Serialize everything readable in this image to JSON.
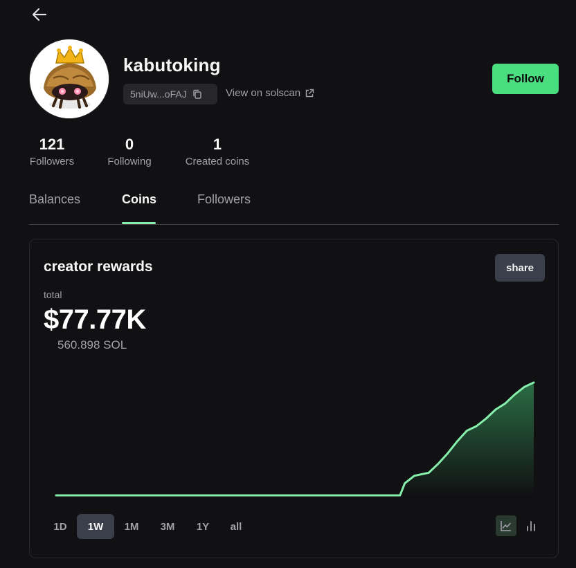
{
  "nav": {
    "back_icon": "arrow-left-icon"
  },
  "profile": {
    "username": "kabutoking",
    "address": "5niUw...oFAJ",
    "copy_icon": "copy-icon",
    "solscan_label": "View on solscan",
    "external_icon": "external-link-icon",
    "follow_label": "Follow"
  },
  "stats": [
    {
      "value": "121",
      "label": "Followers"
    },
    {
      "value": "0",
      "label": "Following"
    },
    {
      "value": "1",
      "label": "Created coins"
    }
  ],
  "tabs": [
    {
      "label": "Balances",
      "active": false
    },
    {
      "label": "Coins",
      "active": true
    },
    {
      "label": "Followers",
      "active": false
    }
  ],
  "rewards": {
    "title": "creator rewards",
    "share_label": "share",
    "total_label": "total",
    "total_value": "$77.77K",
    "sol_value": "560.898 SOL"
  },
  "time_ranges": [
    {
      "label": "1D",
      "active": false
    },
    {
      "label": "1W",
      "active": true
    },
    {
      "label": "1M",
      "active": false
    },
    {
      "label": "3M",
      "active": false
    },
    {
      "label": "1Y",
      "active": false
    },
    {
      "label": "all",
      "active": false
    }
  ],
  "view_toggle": {
    "line_icon": "line-chart-icon",
    "bar_icon": "bar-chart-icon",
    "active": "line"
  },
  "colors": {
    "accent": "#4ade80",
    "line": "#86efac",
    "background": "#111113",
    "muted": "#a1a1aa",
    "chip": "#3a3f4b"
  },
  "chart_data": {
    "type": "area",
    "x": [
      0,
      5,
      10,
      15,
      20,
      25,
      30,
      35,
      40,
      45,
      50,
      55,
      60,
      65,
      70,
      72,
      73,
      75,
      78,
      80,
      82,
      84,
      86,
      88,
      90,
      92,
      94,
      96,
      98,
      100
    ],
    "y": [
      0,
      0,
      0,
      0,
      0,
      0,
      0,
      0,
      0,
      0,
      0,
      0,
      0,
      0,
      0,
      0,
      8,
      13,
      15,
      21,
      28,
      36,
      43,
      46,
      51,
      57,
      61,
      67,
      72,
      75
    ],
    "ylim": [
      0,
      80
    ],
    "grid": false,
    "legend": "none"
  }
}
